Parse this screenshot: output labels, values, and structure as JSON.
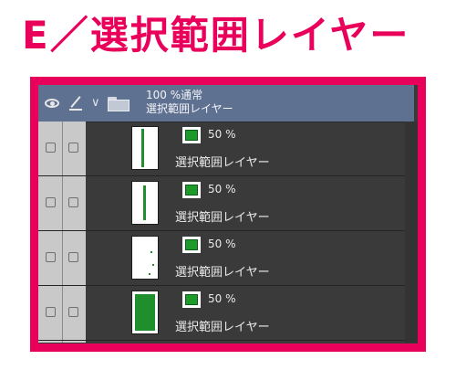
{
  "heading": "E／選択範囲レイヤー",
  "folder": {
    "opacity_blend": "100 %通常",
    "name": "選択範囲レイヤー",
    "folder_icon": "folder-icon",
    "expand_icon": "chevron-down-icon"
  },
  "header_icons": [
    "eye-icon",
    "pen-icon"
  ],
  "layers": [
    {
      "opacity": "50 %",
      "name": "選択範囲レイヤー",
      "thumb": "vertical-line-left"
    },
    {
      "opacity": "50 %",
      "name": "選択範囲レイヤー",
      "thumb": "vertical-line-center"
    },
    {
      "opacity": "50 %",
      "name": "選択範囲レイヤー",
      "thumb": "sparse-dots"
    },
    {
      "opacity": "50 %",
      "name": "選択範囲レイヤー",
      "thumb": "filled"
    }
  ],
  "colors": {
    "accent": "#e8005a",
    "panel_bg": "#3a3a3a",
    "folder_row": "#5f7191",
    "mask_green": "#1e9a2d"
  }
}
